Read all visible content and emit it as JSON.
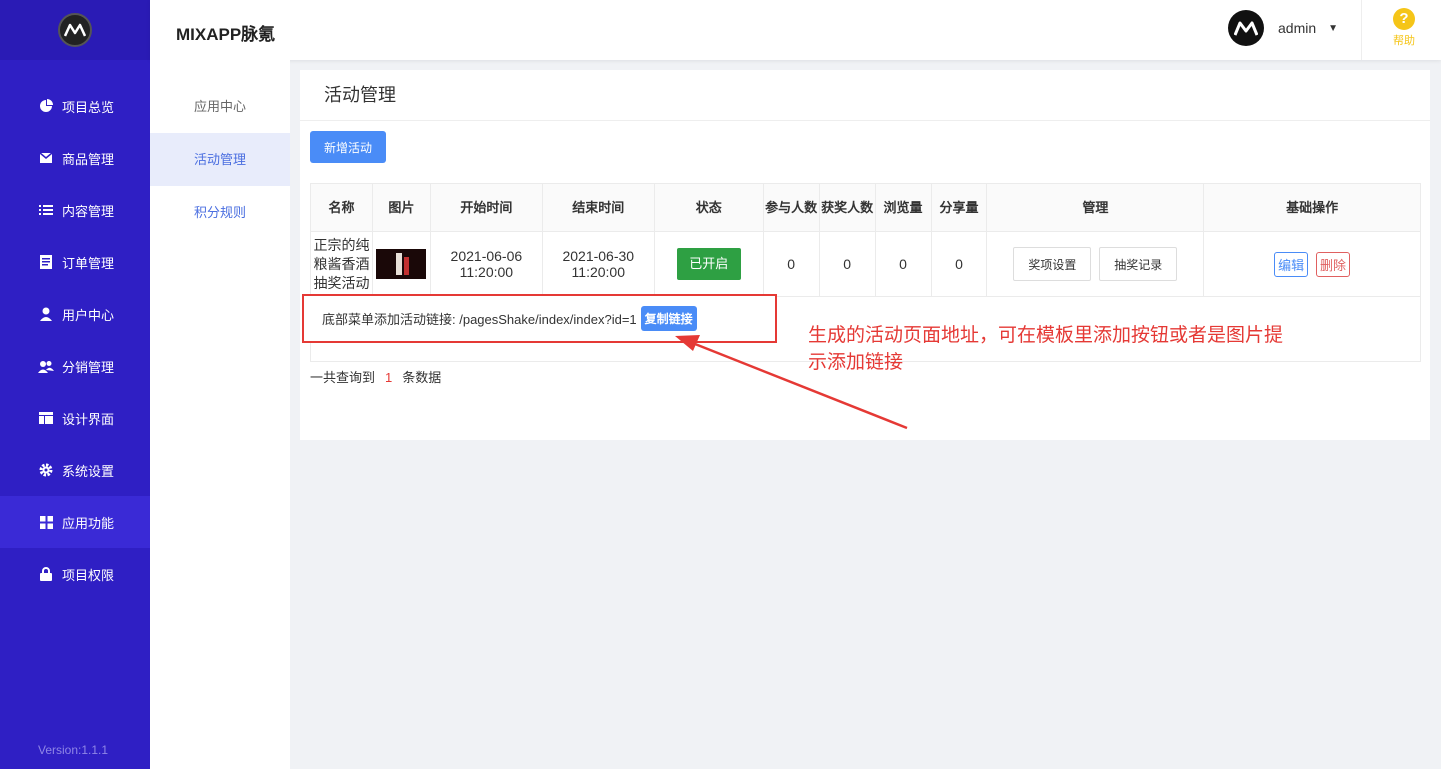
{
  "sidebar": {
    "logo_icon": "mixapp-logo-icon",
    "items": [
      {
        "label": "项目总览",
        "icon": "pie-chart-icon"
      },
      {
        "label": "商品管理",
        "icon": "mail-icon"
      },
      {
        "label": "内容管理",
        "icon": "list-icon"
      },
      {
        "label": "订单管理",
        "icon": "document-icon"
      },
      {
        "label": "用户中心",
        "icon": "user-icon"
      },
      {
        "label": "分销管理",
        "icon": "users-icon"
      },
      {
        "label": "设计界面",
        "icon": "layout-icon"
      },
      {
        "label": "系统设置",
        "icon": "gear-icon"
      },
      {
        "label": "应用功能",
        "icon": "grid-icon"
      },
      {
        "label": "项目权限",
        "icon": "lock-icon"
      }
    ],
    "active_index": 8,
    "version": "Version:1.1.1",
    "bg_color": "#2f1fc4"
  },
  "header": {
    "brand": "MIXAPP脉氪",
    "username": "admin",
    "help_label": "帮助"
  },
  "subnav": {
    "items": [
      "应用中心",
      "活动管理",
      "积分规则"
    ],
    "active_index": 1
  },
  "main": {
    "title": "活动管理",
    "new_button": "新增活动",
    "table": {
      "headers": [
        "名称",
        "图片",
        "开始时间",
        "结束时间",
        "状态",
        "参与人数",
        "获奖人数",
        "浏览量",
        "分享量",
        "管理",
        "基础操作"
      ],
      "rows": [
        {
          "name": "正宗的纯粮酱香酒抽奖活动",
          "start": "2021-06-06 11:20:00",
          "end": "2021-06-30 11:20:00",
          "status": "已开启",
          "participants": "0",
          "winners": "0",
          "views": "0",
          "shares": "0",
          "manage_buttons": [
            "奖项设置",
            "抽奖记录"
          ],
          "edit": "编辑",
          "delete": "删除"
        }
      ]
    },
    "link_label": "底部菜单添加活动链接: /pagesShake/index/index?id=1",
    "copy_button": "复制链接",
    "count_prefix": "一共查询到",
    "count": "1",
    "count_suffix": "条数据"
  },
  "annotation": {
    "text": "生成的活动页面地址，可在模板里添加按钮或者是图片提示添加链接",
    "color": "#e53935"
  }
}
